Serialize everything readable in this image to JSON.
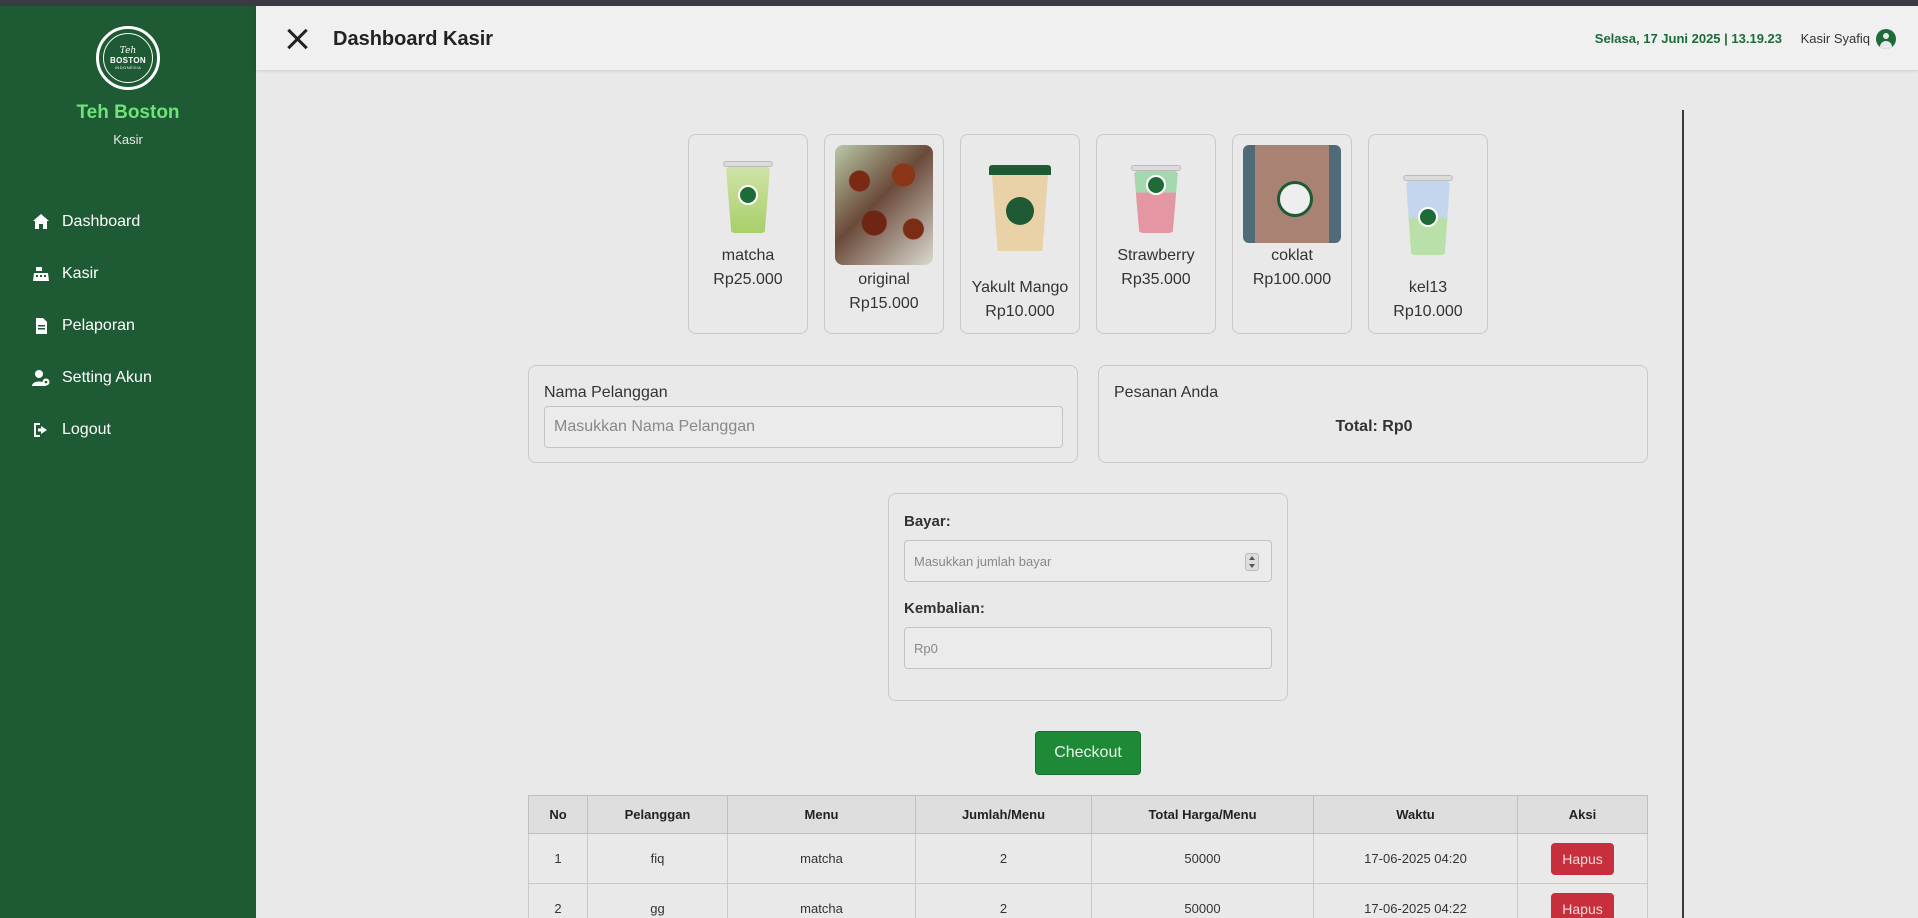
{
  "sidebar": {
    "logo": {
      "top": "Teh",
      "main": "BOSTON",
      "sub": "INDONESIA"
    },
    "brand": "Teh Boston",
    "role": "Kasir",
    "items": [
      {
        "label": "Dashboard",
        "icon": "home-icon"
      },
      {
        "label": "Kasir",
        "icon": "cash-register-icon"
      },
      {
        "label": "Pelaporan",
        "icon": "file-icon"
      },
      {
        "label": "Setting Akun",
        "icon": "user-gear-icon"
      },
      {
        "label": "Logout",
        "icon": "logout-icon"
      }
    ]
  },
  "header": {
    "title": "Dashboard Kasir",
    "datetime": "Selasa, 17 Juni 2025 | 13.19.23",
    "user": "Kasir Syafiq"
  },
  "products": [
    {
      "name": "matcha",
      "price": "Rp25.000"
    },
    {
      "name": "original",
      "price": "Rp15.000"
    },
    {
      "name": "Yakult Mango",
      "price": "Rp10.000"
    },
    {
      "name": "Strawberry",
      "price": "Rp35.000"
    },
    {
      "name": "coklat",
      "price": "Rp100.000"
    },
    {
      "name": "kel13",
      "price": "Rp10.000"
    }
  ],
  "customer": {
    "label": "Nama Pelanggan",
    "placeholder": "Masukkan Nama Pelanggan"
  },
  "order": {
    "label": "Pesanan Anda",
    "total": "Total: Rp0"
  },
  "payment": {
    "pay_label": "Bayar:",
    "pay_placeholder": "Masukkan jumlah bayar",
    "change_label": "Kembalian:",
    "change_placeholder": "Rp0"
  },
  "checkout_label": "Checkout",
  "table": {
    "headers": [
      "No",
      "Pelanggan",
      "Menu",
      "Jumlah/Menu",
      "Total Harga/Menu",
      "Waktu",
      "Aksi"
    ],
    "rows": [
      {
        "no": "1",
        "pelanggan": "fiq",
        "menu": "matcha",
        "jumlah": "2",
        "total": "50000",
        "waktu": "17-06-2025 04:20",
        "aksi": "Hapus"
      },
      {
        "no": "2",
        "pelanggan": "gg",
        "menu": "matcha",
        "jumlah": "2",
        "total": "50000",
        "waktu": "17-06-2025 04:22",
        "aksi": "Hapus"
      }
    ]
  },
  "colors": {
    "sidebar": "#1e5a33",
    "brand": "#6fe27a",
    "accent": "#1e8a37",
    "danger": "#c72f3c"
  }
}
